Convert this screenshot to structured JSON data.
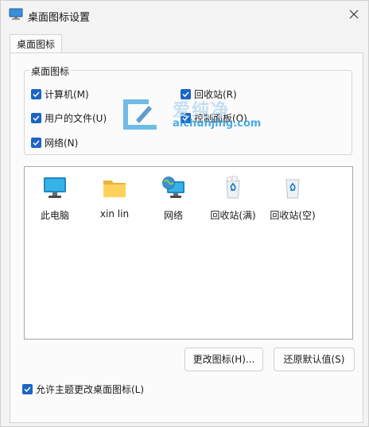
{
  "window": {
    "title": "桌面图标设置"
  },
  "tabs": [
    {
      "label": "桌面图标"
    }
  ],
  "group": {
    "legend": "桌面图标",
    "checkboxes": [
      {
        "label": "计算机(M)",
        "checked": true
      },
      {
        "label": "回收站(R)",
        "checked": true
      },
      {
        "label": "用户的文件(U)",
        "checked": true
      },
      {
        "label": "控制面板(O)",
        "checked": true
      },
      {
        "label": "网络(N)",
        "checked": true
      }
    ]
  },
  "icons": [
    {
      "label": "此电脑",
      "icon": "monitor-icon"
    },
    {
      "label": "xin lin",
      "icon": "folder-icon"
    },
    {
      "label": "网络",
      "icon": "network-icon"
    },
    {
      "label": "回收站(满)",
      "icon": "recycle-bin-full-icon"
    },
    {
      "label": "回收站(空)",
      "icon": "recycle-bin-empty-icon"
    }
  ],
  "buttons": {
    "change_icon": "更改图标(H)...",
    "restore_default": "还原默认值(S)"
  },
  "theme_checkbox": {
    "label": "允许主题更改桌面图标(L)",
    "checked": true
  },
  "watermark": {
    "cn": "爱纯净",
    "en": "aichunjing.com"
  },
  "colors": {
    "checkbox": "#1b65c4",
    "watermark": "#2d9ee0"
  }
}
